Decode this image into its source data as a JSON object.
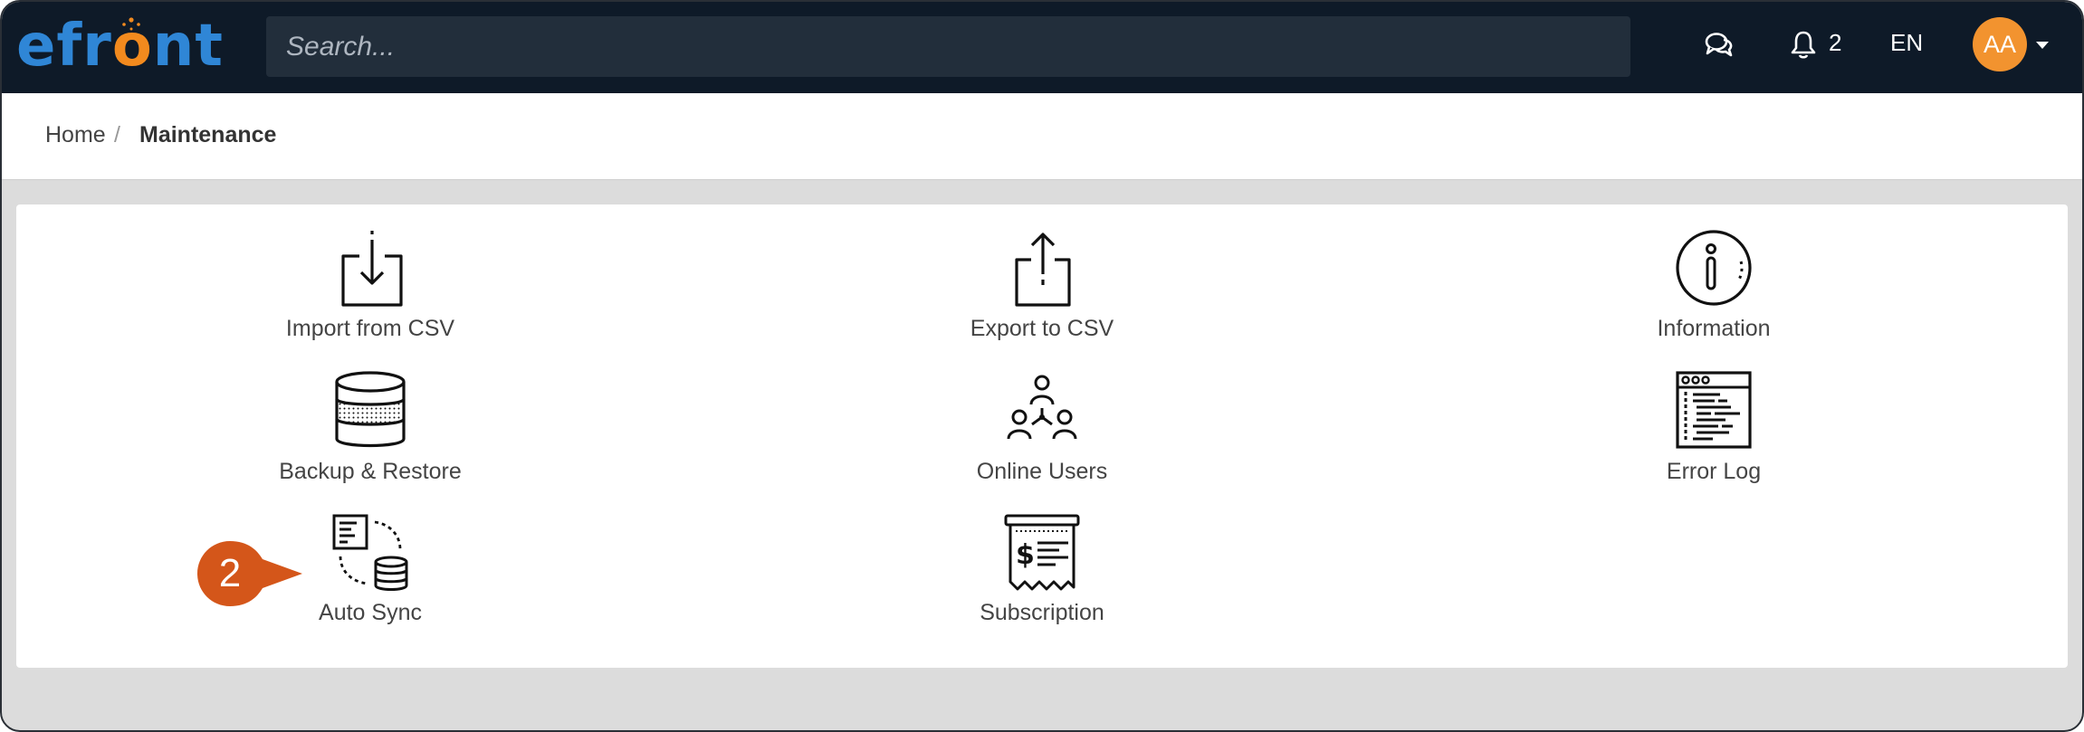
{
  "app": {
    "logo_text_pre": "efr",
    "logo_text_o": "o",
    "logo_text_post": "nt",
    "brand_blue": "#2f86d6",
    "brand_orange": "#f28a1e"
  },
  "header": {
    "search_placeholder": "Search...",
    "chat_icon": "chat-bubbles-icon",
    "bell_icon": "bell-icon",
    "notification_count": "2",
    "language": "EN",
    "avatar_initials": "AA",
    "avatar_color": "#f2932f"
  },
  "breadcrumb": {
    "home": "Home",
    "separator": "/",
    "current": "Maintenance"
  },
  "tools": [
    {
      "label": "Import from CSV",
      "icon": "import-icon"
    },
    {
      "label": "Export to CSV",
      "icon": "export-icon"
    },
    {
      "label": "Information",
      "icon": "info-icon"
    },
    {
      "label": "Backup & Restore",
      "icon": "database-icon"
    },
    {
      "label": "Online Users",
      "icon": "users-network-icon"
    },
    {
      "label": "Error Log",
      "icon": "log-window-icon"
    },
    {
      "label": "Auto Sync",
      "icon": "sync-icon"
    },
    {
      "label": "Subscription",
      "icon": "receipt-icon"
    }
  ],
  "callout": {
    "number": "2",
    "color": "#d4561a"
  }
}
